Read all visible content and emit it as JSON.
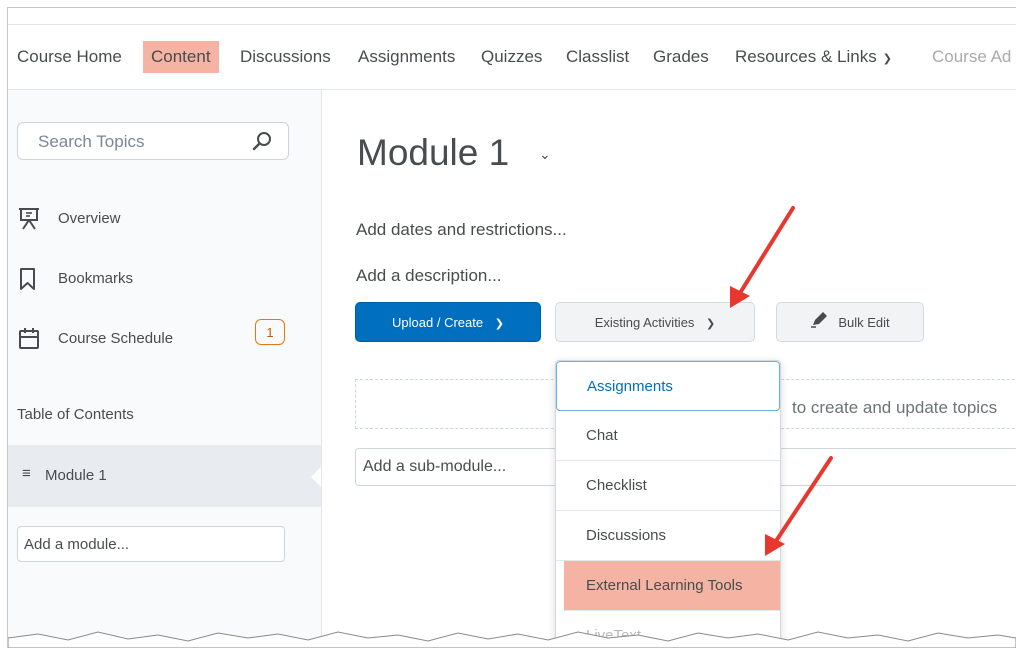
{
  "nav": {
    "items": [
      "Course Home",
      "Content",
      "Discussions",
      "Assignments",
      "Quizzes",
      "Classlist",
      "Grades",
      "Resources & Links",
      "Course Ad"
    ],
    "active": "Content"
  },
  "sidebar": {
    "search_placeholder": "Search Topics",
    "items": [
      {
        "label": "Overview",
        "icon": "presentation-icon"
      },
      {
        "label": "Bookmarks",
        "icon": "bookmark-icon"
      },
      {
        "label": "Course Schedule",
        "icon": "calendar-icon",
        "badge": "1"
      }
    ],
    "toc_label": "Table of Contents",
    "module_label": "Module 1",
    "add_module": "Add a module..."
  },
  "main": {
    "title": "Module 1",
    "add_dates": "Add dates and restrictions...",
    "add_description": "Add a description...",
    "upload_create": "Upload / Create",
    "existing_activities": "Existing Activities",
    "bulk_edit": "Bulk Edit",
    "drop_hint": "to create and update topics",
    "add_submodule": "Add a sub-module..."
  },
  "dropdown": {
    "items": [
      "Assignments",
      "Chat",
      "Checklist",
      "Discussions",
      "External Learning Tools",
      "LiveText"
    ],
    "highlighted": "External Learning Tools"
  },
  "colors": {
    "highlight": "#f4b3a3",
    "primary": "#006fbf",
    "annotation_arrow": "#e8372f",
    "badge": "#e87511"
  }
}
